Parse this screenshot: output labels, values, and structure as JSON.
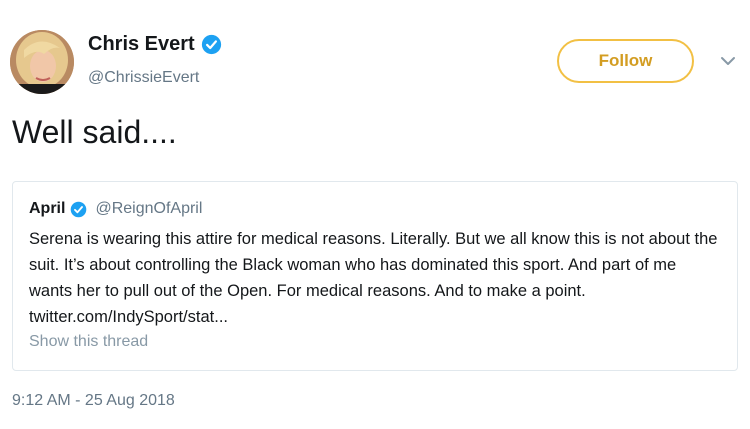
{
  "author": {
    "name": "Chris Evert",
    "handle": "@ChrissieEvert",
    "verified_icon": "verified-badge-icon"
  },
  "follow_button": {
    "label": "Follow",
    "color": "#d39d22",
    "border_color": "#f2c044"
  },
  "menu": {
    "icon": "chevron-down-icon"
  },
  "tweet": {
    "text": "Well said...."
  },
  "quoted_tweet": {
    "name": "April",
    "handle": "@ReignOfApril",
    "text": "Serena is wearing this attire for medical reasons. Literally. But we all know this is not about the suit. It’s about controlling the Black woman who has dominated this sport. And part of me wants her to pull out of the Open. For medical reasons. And to make a point. twitter.com/IndySport/stat...",
    "show_thread": "Show this thread"
  },
  "timestamp": "9:12 AM - 25 Aug 2018",
  "colors": {
    "verified": "#1da1f2",
    "secondary_text": "#657786"
  }
}
